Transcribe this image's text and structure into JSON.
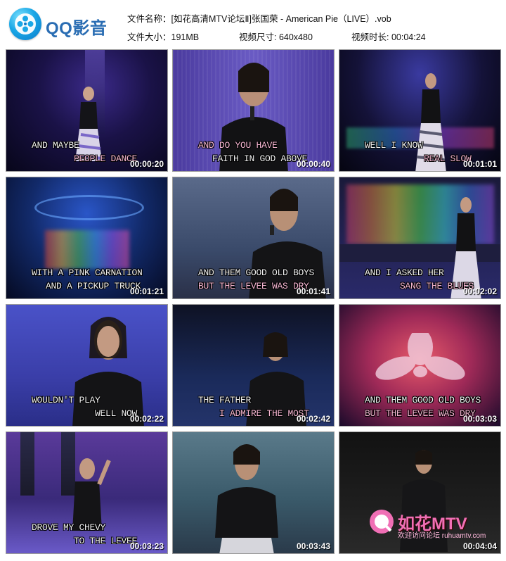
{
  "header": {
    "logo_text": "QQ影音",
    "file_name_label": "文件名称：",
    "file_name": "[如花高清MTV论坛Ⅱ]张国荣 - American Pie（LIVE）.vob",
    "file_size_label": "文件大小：",
    "file_size": "191MB",
    "resolution_label": "视频尺寸: ",
    "resolution": "640x480",
    "duration_label": "视频时长: ",
    "duration": "00:04:24"
  },
  "thumbnails": [
    {
      "line1": "AND MAYBE",
      "line2": "PEOPLE DANCE",
      "time": "00:00:20"
    },
    {
      "line1": "AND DO YOU HAVE",
      "line2": "FAITH IN GOD ABOVE",
      "time": "00:00:40"
    },
    {
      "line1": "WELL I KNOW",
      "line2": "REAL SLOW",
      "time": "00:01:01"
    },
    {
      "line1": "WITH A PINK CARNATION",
      "line2": "AND A PICKUP TRUCK",
      "time": "00:01:21"
    },
    {
      "line1": "AND THEM GOOD OLD BOYS",
      "line2": "BUT THE LEVEE WAS DRY",
      "time": "00:01:41"
    },
    {
      "line1": "AND I ASKED HER",
      "line2": "SANG THE BLUES",
      "time": "00:02:02"
    },
    {
      "line1": "WOULDN'T PLAY",
      "line2": "WELL NOW",
      "time": "00:02:22"
    },
    {
      "line1": "THE FATHER",
      "line2": "I ADMIRE THE MOST",
      "time": "00:02:42"
    },
    {
      "line1": "AND THEM GOOD OLD BOYS",
      "line2": "BUT THE LEVEE WAS DRY",
      "time": "00:03:03"
    },
    {
      "line1": "DROVE MY CHEVY",
      "line2": "TO THE LEVEE",
      "time": "00:03:23"
    },
    {
      "line1": "",
      "line2": "",
      "time": "00:03:43"
    },
    {
      "line1": "",
      "line2": "",
      "time": "00:04:04"
    }
  ],
  "watermark": {
    "text": "如花MTV",
    "sub": "欢迎访问论坛 ruhuamtv.com"
  },
  "colors": {
    "logo_blue": "#2a6db3",
    "subtitle_white": "#f2f2f2",
    "subtitle_pink": "#f8b8d4",
    "watermark_pink": "#f06fb5"
  }
}
